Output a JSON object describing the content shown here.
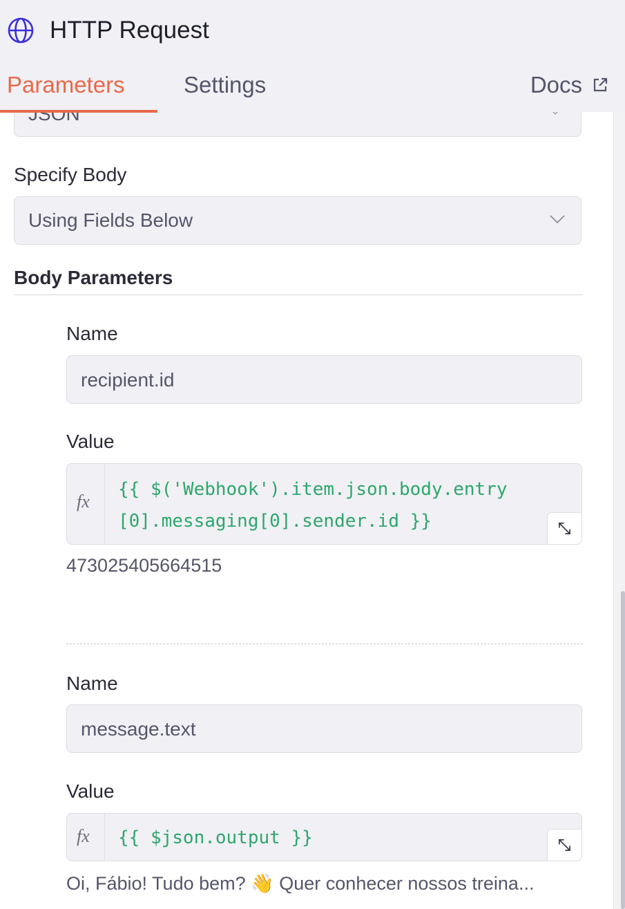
{
  "header": {
    "title": "HTTP Request",
    "tabs": [
      {
        "label": "Parameters",
        "active": true
      },
      {
        "label": "Settings",
        "active": false
      }
    ],
    "docs_label": "Docs",
    "accent_color": "#e8694a",
    "title_icon": "globe-icon",
    "docs_icon": "external-link-icon"
  },
  "body_content_type": {
    "value": "JSON"
  },
  "specify_body": {
    "label": "Specify Body",
    "value": "Using Fields Below"
  },
  "body_parameters": {
    "title": "Body Parameters",
    "items": [
      {
        "name_label": "Name",
        "name_value": "recipient.id",
        "value_label": "Value",
        "fx": "fx",
        "code_lines": [
          "{{ $('Webhook').item.json.body.entry",
          "[0].messaging[0].sender.id }}"
        ],
        "hint": "473025405664515"
      },
      {
        "name_label": "Name",
        "name_value": "message.text",
        "value_label": "Value",
        "fx": "fx",
        "code_lines": [
          "{{ $json.output }}"
        ],
        "hint": "Oi, Fábio! Tudo bem? 👋 Quer conhecer nossos treina..."
      }
    ]
  },
  "colors": {
    "expression_green": "#2ea66c",
    "field_background": "#f0f0f5"
  }
}
